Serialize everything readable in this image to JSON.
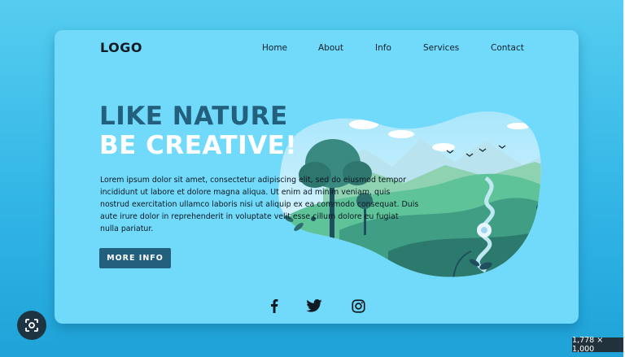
{
  "header": {
    "logo": "LOGO",
    "nav": [
      "Home",
      "About",
      "Info",
      "Services",
      "Contact"
    ]
  },
  "hero": {
    "line1": "LIKE NATURE",
    "line2": "BE CREATIVE!",
    "body": "Lorem ipsum dolor sit amet, consectetur adipiscing elit, sed do eiusmod tempor incididunt ut labore et dolore magna aliqua. Ut enim ad minim veniam, quis nostrud exercitation ullamco laboris nisi ut aliquip ex ea commodo consequat. Duis aute irure dolor in reprehenderit in voluptate velit esse cillum dolore eu fugiat nulla pariatur.",
    "button": "MORE INFO"
  },
  "social": [
    "facebook-icon",
    "twitter-icon",
    "instagram-icon"
  ],
  "viewer": {
    "dimensions": "1,778 × 1,000",
    "lens_icon": "lens-icon"
  },
  "colors": {
    "background": "#33b6e6",
    "card": "#71dafb",
    "heading_dark": "#22607e",
    "heading_light": "#ffffff",
    "button": "#23607d"
  }
}
